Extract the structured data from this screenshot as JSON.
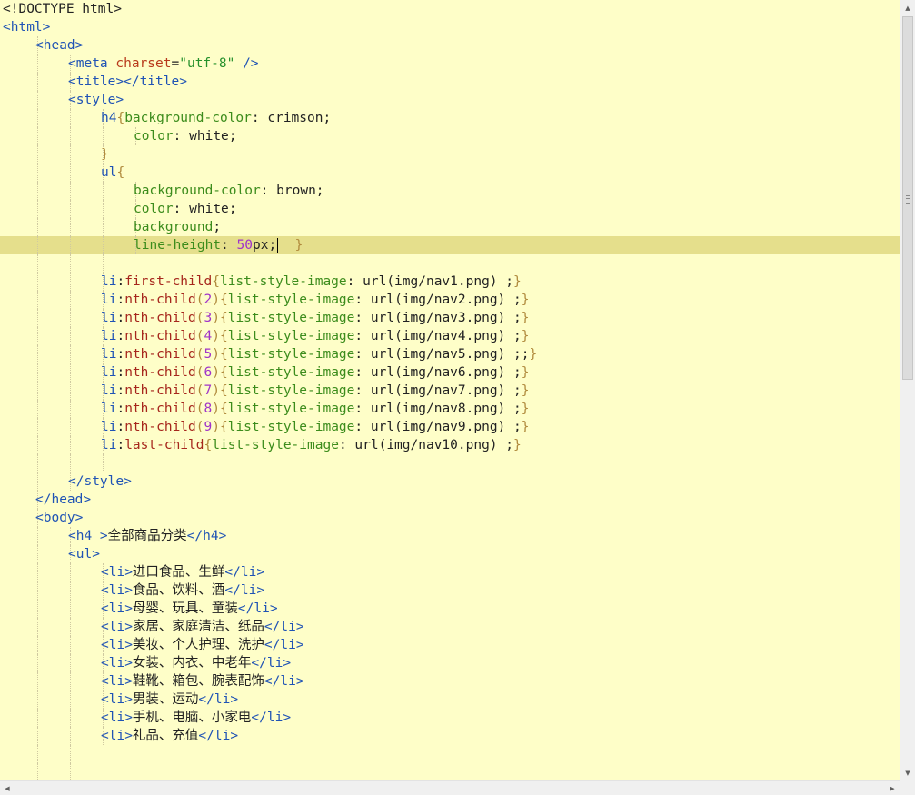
{
  "editor": {
    "colors": {
      "background": "#fefec8",
      "current_line": "#e5df8c",
      "tag": "#1f53b5",
      "attribute": "#b83a1c",
      "string": "#26912c",
      "property": "#3c8c1c",
      "number": "#a033c9",
      "bracket": "#b08a3c",
      "pseudo": "#a6261c",
      "text": "#222222"
    },
    "lines": [
      {
        "i": 0,
        "t": [
          [
            "<!DOCTYPE html>",
            "#222"
          ]
        ]
      },
      {
        "i": 0,
        "t": [
          [
            "<html>",
            "#1f53b5"
          ]
        ]
      },
      {
        "i": 1,
        "t": [
          [
            "<head>",
            "#1f53b5"
          ]
        ]
      },
      {
        "i": 2,
        "t": [
          [
            "<meta ",
            "#1f53b5"
          ],
          [
            "charset",
            "#b83a1c"
          ],
          [
            "=",
            "#222"
          ],
          [
            "\"utf-8\"",
            "#26912c"
          ],
          [
            " />",
            "#1f53b5"
          ]
        ]
      },
      {
        "i": 2,
        "t": [
          [
            "<title></title>",
            "#1f53b5"
          ]
        ]
      },
      {
        "i": 2,
        "t": [
          [
            "<style>",
            "#1f53b5"
          ]
        ]
      },
      {
        "i": 3,
        "t": [
          [
            "h4",
            "#1f53b5"
          ],
          [
            "{",
            "#b08a3c"
          ],
          [
            "background-color",
            "#3c8c1c"
          ],
          [
            ": ",
            "#222"
          ],
          [
            "crimson;",
            "#222"
          ]
        ]
      },
      {
        "i": 4,
        "t": [
          [
            "color",
            "#3c8c1c"
          ],
          [
            ": ",
            "#222"
          ],
          [
            "white;",
            "#222"
          ]
        ]
      },
      {
        "i": 3,
        "t": [
          [
            "}",
            "#b08a3c"
          ]
        ]
      },
      {
        "i": 3,
        "t": [
          [
            "ul",
            "#1f53b5"
          ],
          [
            "{",
            "#b08a3c"
          ]
        ]
      },
      {
        "i": 4,
        "t": [
          [
            "background-color",
            "#3c8c1c"
          ],
          [
            ": ",
            "#222"
          ],
          [
            "brown;",
            "#222"
          ]
        ]
      },
      {
        "i": 4,
        "t": [
          [
            "color",
            "#3c8c1c"
          ],
          [
            ": ",
            "#222"
          ],
          [
            "white;",
            "#222"
          ]
        ]
      },
      {
        "i": 4,
        "t": [
          [
            "background",
            "#3c8c1c"
          ],
          [
            ";",
            "#222"
          ]
        ]
      },
      {
        "i": 4,
        "active": true,
        "t": [
          [
            "line-height",
            "#3c8c1c"
          ],
          [
            ": ",
            "#222"
          ],
          [
            "50",
            "#a033c9"
          ],
          [
            "px",
            "#222"
          ],
          [
            ";",
            "#222"
          ],
          [
            "|caret",
            ""
          ],
          [
            "  }",
            "#b08a3c"
          ]
        ]
      },
      {
        "i": 0,
        "t": []
      },
      {
        "i": 3,
        "t": [
          [
            "li",
            "#1f53b5"
          ],
          [
            ":",
            "#222"
          ],
          [
            "first-child",
            "#a6261c"
          ],
          [
            "{",
            "#b08a3c"
          ],
          [
            "list-style-image",
            "#3c8c1c"
          ],
          [
            ": ",
            "#222"
          ],
          [
            "url(img/nav1.png) ;",
            "#222"
          ],
          [
            "}",
            "#b08a3c"
          ]
        ]
      },
      {
        "i": 3,
        "t": [
          [
            "li",
            "#1f53b5"
          ],
          [
            ":",
            "#222"
          ],
          [
            "nth-child",
            "#a6261c"
          ],
          [
            "(",
            "#b08a3c"
          ],
          [
            "2",
            "#a033c9"
          ],
          [
            ")",
            "#b08a3c"
          ],
          [
            "{",
            "#b08a3c"
          ],
          [
            "list-style-image",
            "#3c8c1c"
          ],
          [
            ": ",
            "#222"
          ],
          [
            "url(img/nav2.png) ;",
            "#222"
          ],
          [
            "}",
            "#b08a3c"
          ]
        ]
      },
      {
        "i": 3,
        "t": [
          [
            "li",
            "#1f53b5"
          ],
          [
            ":",
            "#222"
          ],
          [
            "nth-child",
            "#a6261c"
          ],
          [
            "(",
            "#b08a3c"
          ],
          [
            "3",
            "#a033c9"
          ],
          [
            ")",
            "#b08a3c"
          ],
          [
            "{",
            "#b08a3c"
          ],
          [
            "list-style-image",
            "#3c8c1c"
          ],
          [
            ": ",
            "#222"
          ],
          [
            "url(img/nav3.png) ;",
            "#222"
          ],
          [
            "}",
            "#b08a3c"
          ]
        ]
      },
      {
        "i": 3,
        "t": [
          [
            "li",
            "#1f53b5"
          ],
          [
            ":",
            "#222"
          ],
          [
            "nth-child",
            "#a6261c"
          ],
          [
            "(",
            "#b08a3c"
          ],
          [
            "4",
            "#a033c9"
          ],
          [
            ")",
            "#b08a3c"
          ],
          [
            "{",
            "#b08a3c"
          ],
          [
            "list-style-image",
            "#3c8c1c"
          ],
          [
            ": ",
            "#222"
          ],
          [
            "url(img/nav4.png) ;",
            "#222"
          ],
          [
            "}",
            "#b08a3c"
          ]
        ]
      },
      {
        "i": 3,
        "t": [
          [
            "li",
            "#1f53b5"
          ],
          [
            ":",
            "#222"
          ],
          [
            "nth-child",
            "#a6261c"
          ],
          [
            "(",
            "#b08a3c"
          ],
          [
            "5",
            "#a033c9"
          ],
          [
            ")",
            "#b08a3c"
          ],
          [
            "{",
            "#b08a3c"
          ],
          [
            "list-style-image",
            "#3c8c1c"
          ],
          [
            ": ",
            "#222"
          ],
          [
            "url(img/nav5.png) ;;",
            "#222"
          ],
          [
            "}",
            "#b08a3c"
          ]
        ]
      },
      {
        "i": 3,
        "t": [
          [
            "li",
            "#1f53b5"
          ],
          [
            ":",
            "#222"
          ],
          [
            "nth-child",
            "#a6261c"
          ],
          [
            "(",
            "#b08a3c"
          ],
          [
            "6",
            "#a033c9"
          ],
          [
            ")",
            "#b08a3c"
          ],
          [
            "{",
            "#b08a3c"
          ],
          [
            "list-style-image",
            "#3c8c1c"
          ],
          [
            ": ",
            "#222"
          ],
          [
            "url(img/nav6.png) ;",
            "#222"
          ],
          [
            "}",
            "#b08a3c"
          ]
        ]
      },
      {
        "i": 3,
        "t": [
          [
            "li",
            "#1f53b5"
          ],
          [
            ":",
            "#222"
          ],
          [
            "nth-child",
            "#a6261c"
          ],
          [
            "(",
            "#b08a3c"
          ],
          [
            "7",
            "#a033c9"
          ],
          [
            ")",
            "#b08a3c"
          ],
          [
            "{",
            "#b08a3c"
          ],
          [
            "list-style-image",
            "#3c8c1c"
          ],
          [
            ": ",
            "#222"
          ],
          [
            "url(img/nav7.png) ;",
            "#222"
          ],
          [
            "}",
            "#b08a3c"
          ]
        ]
      },
      {
        "i": 3,
        "t": [
          [
            "li",
            "#1f53b5"
          ],
          [
            ":",
            "#222"
          ],
          [
            "nth-child",
            "#a6261c"
          ],
          [
            "(",
            "#b08a3c"
          ],
          [
            "8",
            "#a033c9"
          ],
          [
            ")",
            "#b08a3c"
          ],
          [
            "{",
            "#b08a3c"
          ],
          [
            "list-style-image",
            "#3c8c1c"
          ],
          [
            ": ",
            "#222"
          ],
          [
            "url(img/nav8.png) ;",
            "#222"
          ],
          [
            "}",
            "#b08a3c"
          ]
        ]
      },
      {
        "i": 3,
        "t": [
          [
            "li",
            "#1f53b5"
          ],
          [
            ":",
            "#222"
          ],
          [
            "nth-child",
            "#a6261c"
          ],
          [
            "(",
            "#b08a3c"
          ],
          [
            "9",
            "#a033c9"
          ],
          [
            ")",
            "#b08a3c"
          ],
          [
            "{",
            "#b08a3c"
          ],
          [
            "list-style-image",
            "#3c8c1c"
          ],
          [
            ": ",
            "#222"
          ],
          [
            "url(img/nav9.png) ;",
            "#222"
          ],
          [
            "}",
            "#b08a3c"
          ]
        ]
      },
      {
        "i": 3,
        "t": [
          [
            "li",
            "#1f53b5"
          ],
          [
            ":",
            "#222"
          ],
          [
            "last-child",
            "#a6261c"
          ],
          [
            "{",
            "#b08a3c"
          ],
          [
            "list-style-image",
            "#3c8c1c"
          ],
          [
            ": ",
            "#222"
          ],
          [
            "url(img/nav10.png) ;",
            "#222"
          ],
          [
            "}",
            "#b08a3c"
          ]
        ]
      },
      {
        "i": 0,
        "t": []
      },
      {
        "i": 2,
        "t": [
          [
            "</style>",
            "#1f53b5"
          ]
        ]
      },
      {
        "i": 1,
        "t": [
          [
            "</head>",
            "#1f53b5"
          ]
        ]
      },
      {
        "i": 1,
        "t": [
          [
            "<body>",
            "#1f53b5"
          ]
        ]
      },
      {
        "i": 2,
        "t": [
          [
            "<h4 >",
            "#1f53b5"
          ],
          [
            "全部商品分类",
            "#222"
          ],
          [
            "</h4>",
            "#1f53b5"
          ]
        ]
      },
      {
        "i": 2,
        "t": [
          [
            "<ul>",
            "#1f53b5"
          ]
        ]
      },
      {
        "i": 3,
        "t": [
          [
            "<li>",
            "#1f53b5"
          ],
          [
            "进口食品、生鲜",
            "#222"
          ],
          [
            "</li>",
            "#1f53b5"
          ]
        ]
      },
      {
        "i": 3,
        "t": [
          [
            "<li>",
            "#1f53b5"
          ],
          [
            "食品、饮料、酒",
            "#222"
          ],
          [
            "</li>",
            "#1f53b5"
          ]
        ]
      },
      {
        "i": 3,
        "t": [
          [
            "<li>",
            "#1f53b5"
          ],
          [
            "母婴、玩具、童装",
            "#222"
          ],
          [
            "</li>",
            "#1f53b5"
          ]
        ]
      },
      {
        "i": 3,
        "t": [
          [
            "<li>",
            "#1f53b5"
          ],
          [
            "家居、家庭清洁、纸品",
            "#222"
          ],
          [
            "</li>",
            "#1f53b5"
          ]
        ]
      },
      {
        "i": 3,
        "t": [
          [
            "<li>",
            "#1f53b5"
          ],
          [
            "美妆、个人护理、洗护",
            "#222"
          ],
          [
            "</li>",
            "#1f53b5"
          ]
        ]
      },
      {
        "i": 3,
        "t": [
          [
            "<li>",
            "#1f53b5"
          ],
          [
            "女装、内衣、中老年",
            "#222"
          ],
          [
            "</li>",
            "#1f53b5"
          ]
        ]
      },
      {
        "i": 3,
        "t": [
          [
            "<li>",
            "#1f53b5"
          ],
          [
            "鞋靴、箱包、腕表配饰",
            "#222"
          ],
          [
            "</li>",
            "#1f53b5"
          ]
        ]
      },
      {
        "i": 3,
        "t": [
          [
            "<li>",
            "#1f53b5"
          ],
          [
            "男装、运动",
            "#222"
          ],
          [
            "</li>",
            "#1f53b5"
          ]
        ]
      },
      {
        "i": 3,
        "t": [
          [
            "<li>",
            "#1f53b5"
          ],
          [
            "手机、电脑、小家电",
            "#222"
          ],
          [
            "</li>",
            "#1f53b5"
          ]
        ]
      },
      {
        "i": 3,
        "t": [
          [
            "<li>",
            "#1f53b5"
          ],
          [
            "礼品、充值",
            "#222"
          ],
          [
            "</li>",
            "#1f53b5"
          ]
        ]
      },
      {
        "i": 0,
        "t": []
      },
      {
        "i": 0,
        "t": []
      }
    ]
  },
  "scrollbars": {
    "up_icon": "triangle-up",
    "down_icon": "triangle-down",
    "left_icon": "triangle-left",
    "right_icon": "triangle-right",
    "up_glyph": "▲",
    "down_glyph": "▼",
    "left_glyph": "◀",
    "right_glyph": "▶"
  }
}
